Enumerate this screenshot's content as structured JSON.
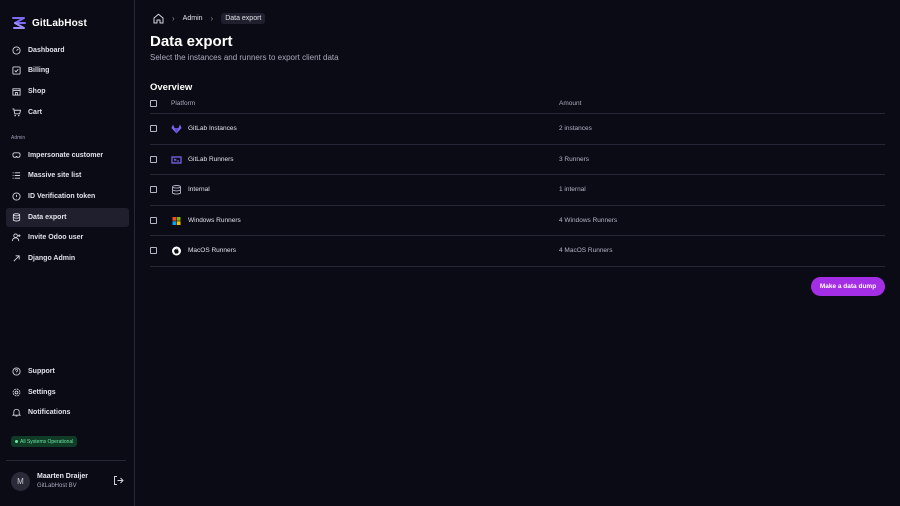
{
  "brand": {
    "name": "GitLabHost"
  },
  "sidebar": {
    "main_items": [
      {
        "label": "Dashboard",
        "icon": "dashboard-icon"
      },
      {
        "label": "Billing",
        "icon": "billing-icon"
      },
      {
        "label": "Shop",
        "icon": "shop-icon"
      },
      {
        "label": "Cart",
        "icon": "cart-icon"
      }
    ],
    "admin_label": "Admin",
    "admin_items": [
      {
        "label": "Impersonate customer",
        "icon": "impersonate-icon"
      },
      {
        "label": "Massive site list",
        "icon": "list-icon"
      },
      {
        "label": "ID Verification token",
        "icon": "verification-icon"
      },
      {
        "label": "Data export",
        "icon": "database-icon",
        "active": true
      },
      {
        "label": "Invite Odoo user",
        "icon": "user-plus-icon"
      },
      {
        "label": "Django Admin",
        "icon": "arrow-up-right-icon"
      }
    ],
    "bottom_items": [
      {
        "label": "Support",
        "icon": "support-icon"
      },
      {
        "label": "Settings",
        "icon": "settings-icon"
      },
      {
        "label": "Notifications",
        "icon": "bell-icon"
      }
    ],
    "status": "All Systems Operational",
    "user": {
      "initial": "M",
      "name": "Maarten Draijer",
      "org": "GitLabHost BV"
    }
  },
  "breadcrumb": {
    "items": [
      "Admin",
      "Data export"
    ]
  },
  "page": {
    "title": "Data export",
    "subtitle": "Select the instances and runners to export client data",
    "section_title": "Overview"
  },
  "table": {
    "headers": {
      "platform": "Platform",
      "amount": "Amount"
    },
    "rows": [
      {
        "platform": "GitLab Instances",
        "amount": "2 instances",
        "icon": "gitlab-icon"
      },
      {
        "platform": "GitLab Runners",
        "amount": "3 Runners",
        "icon": "runner-icon"
      },
      {
        "platform": "Internal",
        "amount": "1 internal",
        "icon": "database-icon"
      },
      {
        "platform": "Windows Runners",
        "amount": "4 Windows Runners",
        "icon": "windows-icon"
      },
      {
        "platform": "MacOS Runners",
        "amount": "4 MacOS Runners",
        "icon": "apple-icon"
      }
    ]
  },
  "actions": {
    "dump_button": "Make a data dump"
  },
  "colors": {
    "accent": "#a42ee6",
    "background": "#0b0b16",
    "status": "#6ee7a1"
  }
}
